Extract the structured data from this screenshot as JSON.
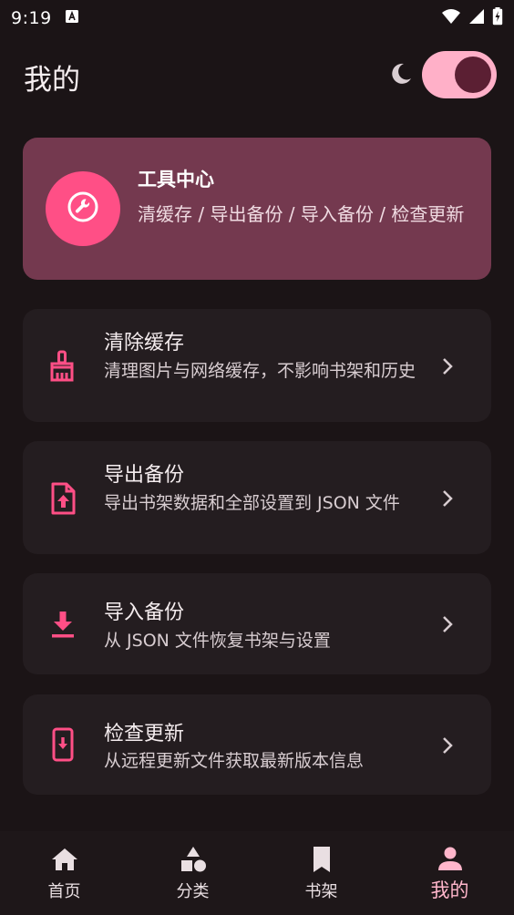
{
  "status_bar": {
    "time": "9:19"
  },
  "header": {
    "title": "我的"
  },
  "tools_card": {
    "title": "工具中心",
    "description": "清缓存 / 导出备份 / 导入备份 / 检查更新"
  },
  "items": [
    {
      "title": "清除缓存",
      "description": "清理图片与网络缓存，不影响书架和历史"
    },
    {
      "title": "导出备份",
      "description": "导出书架数据和全部设置到 JSON 文件"
    },
    {
      "title": "导入备份",
      "description": "从 JSON 文件恢复书架与设置"
    },
    {
      "title": "检查更新",
      "description": "从远程更新文件获取最新版本信息"
    }
  ],
  "bottom_nav": {
    "items": [
      {
        "label": "首页"
      },
      {
        "label": "分类"
      },
      {
        "label": "书架"
      },
      {
        "label": "我的"
      }
    ],
    "active_index": 3
  },
  "colors": {
    "background": "#1b1416",
    "accent": "#ff4f86",
    "card": "#74394f",
    "item": "#241d20",
    "active_nav": "#ffb6cb"
  }
}
